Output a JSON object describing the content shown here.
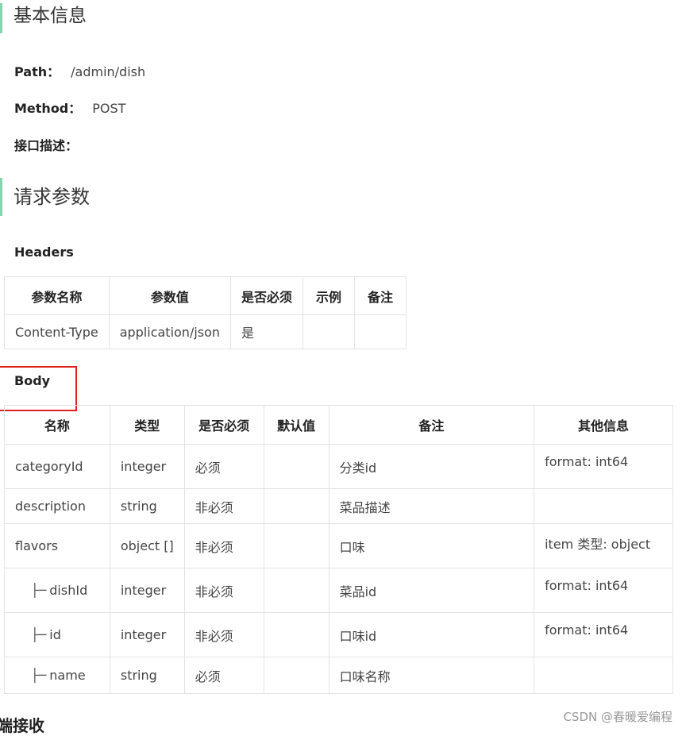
{
  "section1_title": "基本信息",
  "path_label": "Path：",
  "path_value": "/admin/dish",
  "method_label": "Method：",
  "method_value": "POST",
  "desc_label": "接口描述：",
  "section2_title": "请求参数",
  "headers_label": "Headers",
  "headers_table": {
    "columns": [
      "参数名称",
      "参数值",
      "是否必须",
      "示例",
      "备注"
    ],
    "rows": [
      [
        "Content-Type",
        "application/json",
        "是",
        "",
        ""
      ]
    ]
  },
  "body_label": "Body",
  "body_table": {
    "columns": [
      "名称",
      "类型",
      "是否必须",
      "默认值",
      "备注",
      "其他信息"
    ],
    "rows": [
      {
        "name": "categoryId",
        "type": "integer",
        "required": "必须",
        "default": "",
        "note": "分类id",
        "other": "format: int64"
      },
      {
        "name": "description",
        "type": "string",
        "required": "非必须",
        "default": "",
        "note": "菜品描述",
        "other": ""
      },
      {
        "name": "flavors",
        "type": "object []",
        "required": "非必须",
        "default": "",
        "note": "口味",
        "other": "item 类型: object"
      },
      {
        "name": "dishId",
        "type": "integer",
        "required": "非必须",
        "default": "",
        "note": "菜品id",
        "other": "format: int64"
      },
      {
        "name": "id",
        "type": "integer",
        "required": "非必须",
        "default": "",
        "note": "口味id",
        "other": "format: int64"
      },
      {
        "name": "name",
        "type": "string",
        "required": "必须",
        "default": "",
        "note": "口味名称",
        "other": ""
      }
    ],
    "branch_glyph": "├─"
  },
  "bottom_label": "端接收",
  "watermark": "CSDN @春暖爱编程"
}
